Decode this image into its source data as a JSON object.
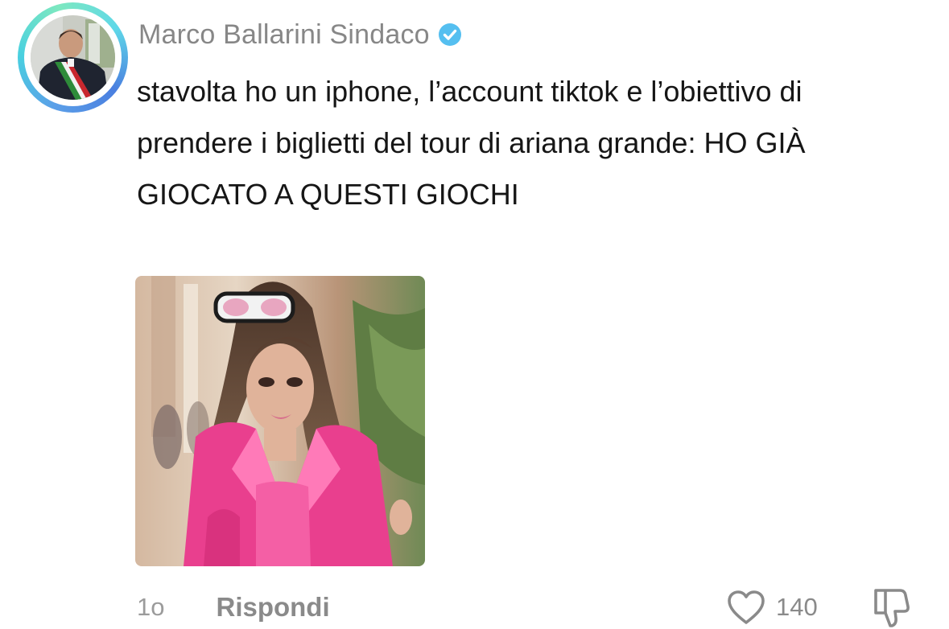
{
  "comment": {
    "author": "Marco Ballarini Sindaco",
    "verified": true,
    "text": "stavolta ho un iphone, l’account tiktok e l’obiettivo di prendere i biglietti del tour di ariana grande: HO GIÀ GIOCATO A QUESTI GIOCHI",
    "timestamp": "1o",
    "reply_label": "Rispondi",
    "like_count": "140"
  },
  "icons": {
    "verified": "verified-check-icon",
    "like": "heart-outline-icon",
    "dislike": "thumbs-down-outline-icon"
  },
  "colors": {
    "verified_blue": "#55BFF0",
    "username_gray": "#878787",
    "text": "#161616",
    "meta_gray": "#8A8A8A",
    "ring_gradient": [
      "#5B9FE8",
      "#49D0E0",
      "#7DE8C0"
    ]
  }
}
